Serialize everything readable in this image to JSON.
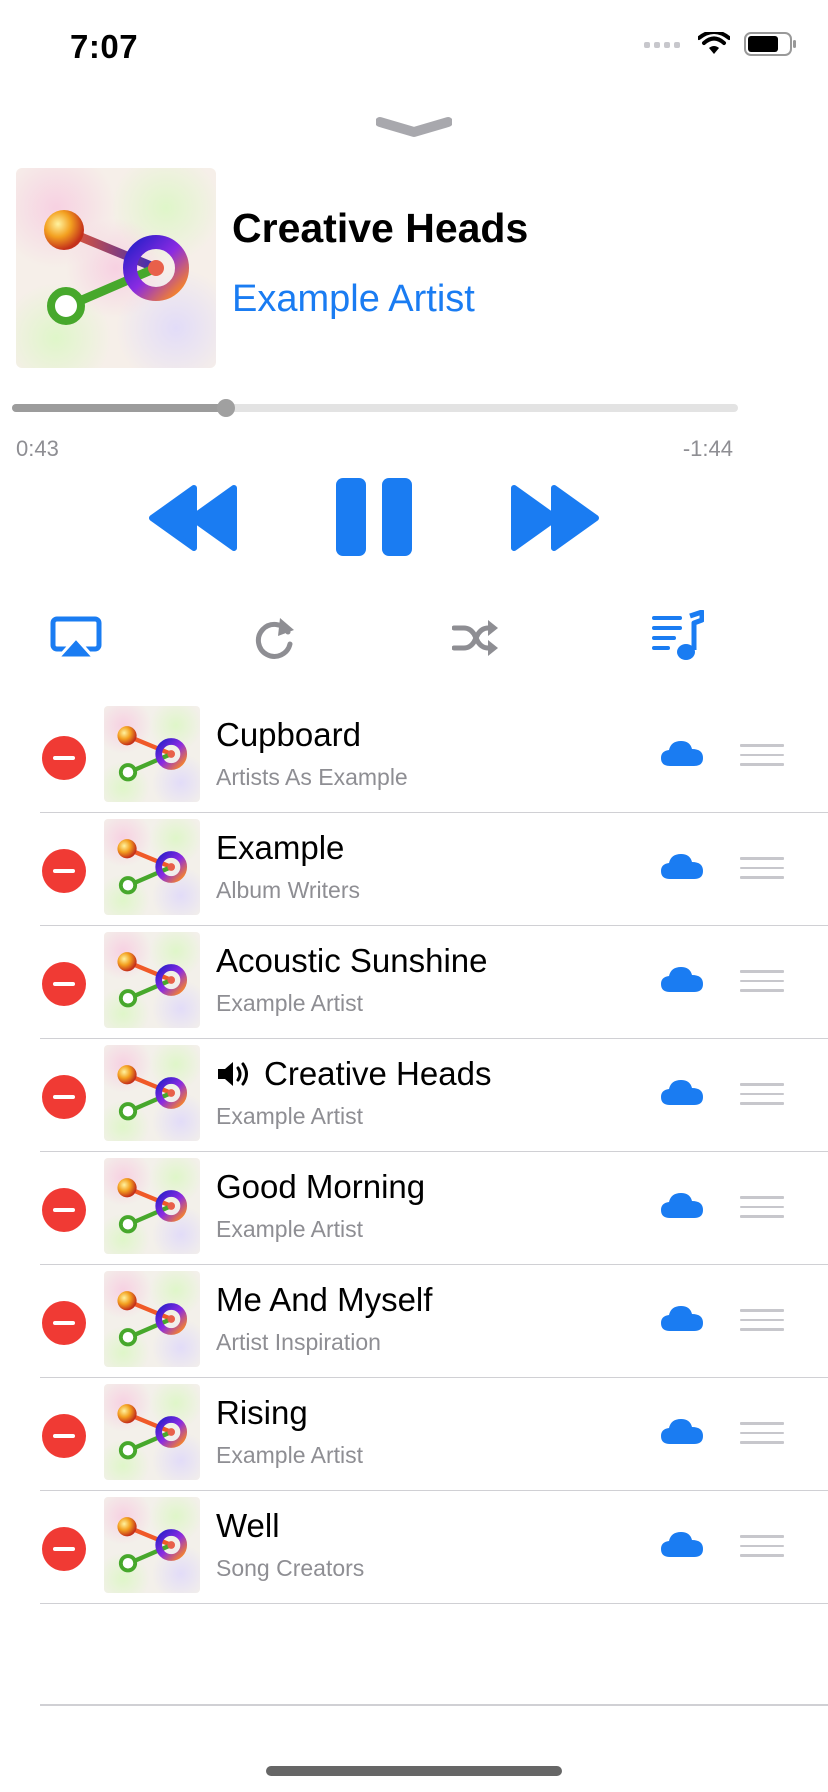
{
  "status_bar": {
    "time": "7:07"
  },
  "now_playing": {
    "title": "Creative Heads",
    "artist": "Example Artist",
    "elapsed": "0:43",
    "remaining": "-1:44",
    "progress": 0.295
  },
  "controls": {
    "previous_icon": "backward-icon",
    "pause_icon": "pause-icon",
    "next_icon": "forward-icon",
    "airplay_icon": "airplay-icon",
    "repeat_icon": "repeat-icon",
    "shuffle_icon": "shuffle-icon",
    "queue_icon": "queue-list-icon"
  },
  "colors": {
    "accent": "#1a7cf2",
    "delete": "#f03a34",
    "muted": "#8e8e93"
  },
  "queue": [
    {
      "title": "Cupboard",
      "subtitle": "Artists As Example",
      "playing": false
    },
    {
      "title": "Example",
      "subtitle": "Album Writers",
      "playing": false
    },
    {
      "title": "Acoustic Sunshine",
      "subtitle": "Example Artist",
      "playing": false
    },
    {
      "title": "Creative Heads",
      "subtitle": "Example Artist",
      "playing": true
    },
    {
      "title": "Good Morning",
      "subtitle": "Example Artist",
      "playing": false
    },
    {
      "title": "Me And Myself",
      "subtitle": "Artist Inspiration",
      "playing": false
    },
    {
      "title": "Rising",
      "subtitle": "Example Artist",
      "playing": false
    },
    {
      "title": "Well",
      "subtitle": "Song Creators",
      "playing": false
    }
  ]
}
